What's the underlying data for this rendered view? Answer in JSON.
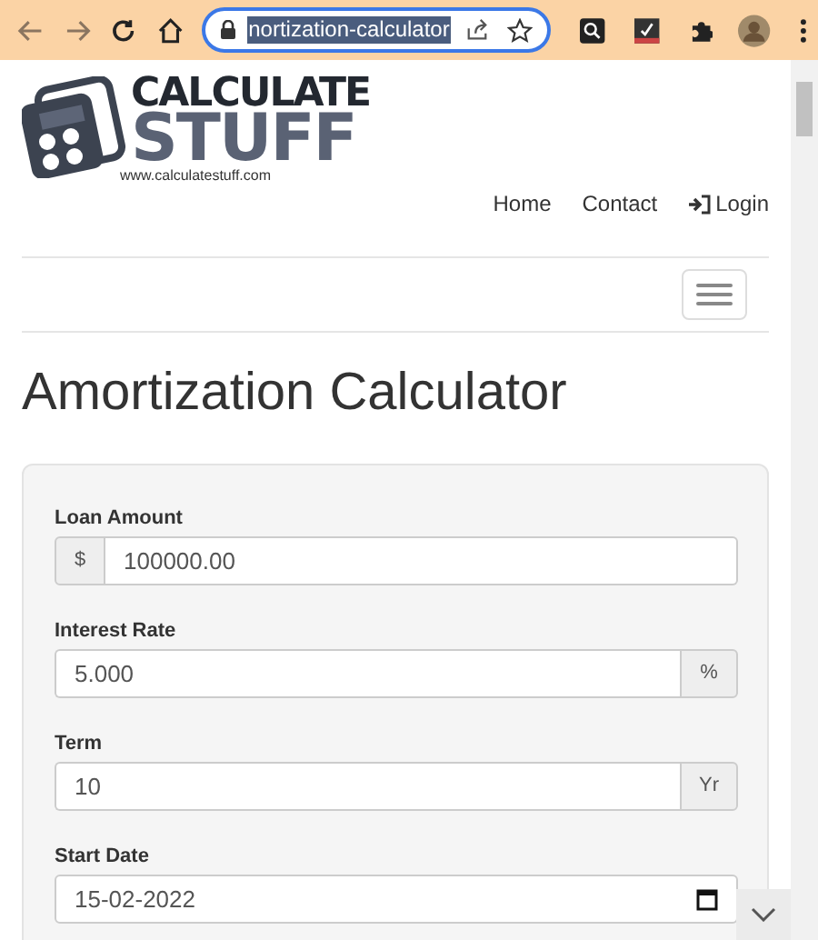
{
  "browser": {
    "url": "nortization-calculator"
  },
  "logo": {
    "line_1": "CALCULATE",
    "line_2": "STUFF",
    "site": "www.calculatestuff.com"
  },
  "nav": [
    {
      "kind": "link",
      "label": "Home"
    },
    {
      "kind": "link",
      "label": "Contact"
    },
    {
      "kind": "login",
      "label": "Login"
    }
  ],
  "title": "Amortization Calculator",
  "fields": [
    {
      "label": "Loan Amount",
      "value": "100000.00",
      "prefix": "$"
    },
    {
      "label": "Interest Rate",
      "value": "5.000",
      "suffix": "%"
    },
    {
      "label": "Term",
      "value": "10",
      "suffix": "Yr"
    },
    {
      "label": "Start Date",
      "value": "15-02-2022",
      "kind": "date"
    }
  ]
}
